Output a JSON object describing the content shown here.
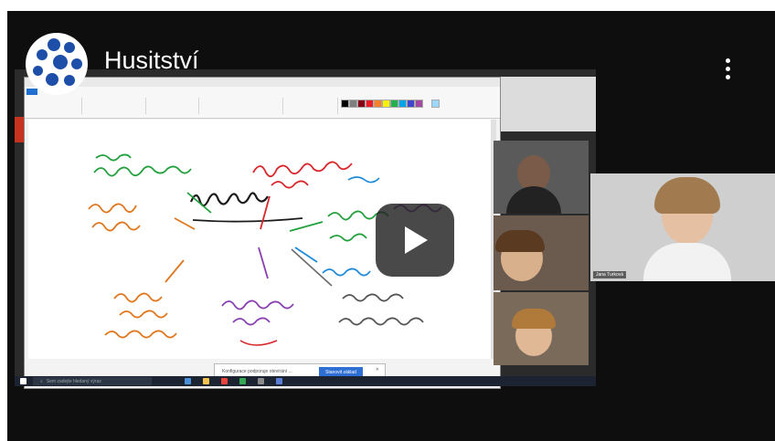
{
  "video": {
    "title": "Husitství"
  },
  "icons": {
    "channel": "channel-logo-icon",
    "menu": "more-vert-icon",
    "play": "play-icon",
    "start": "windows-start-icon",
    "search": "search-icon"
  },
  "colors": {
    "player_bg": "#0e0e0e",
    "play_button": "#212121",
    "logo_blue": "#1e4fa8"
  },
  "notification": {
    "text": "Konfigurace podporuje otevírání ...",
    "button_label": "Stanovit základ"
  },
  "taskbar": {
    "search_placeholder": "Sem zadejte hledaný výraz"
  },
  "participants": {
    "main_name": "Jana Turková"
  }
}
